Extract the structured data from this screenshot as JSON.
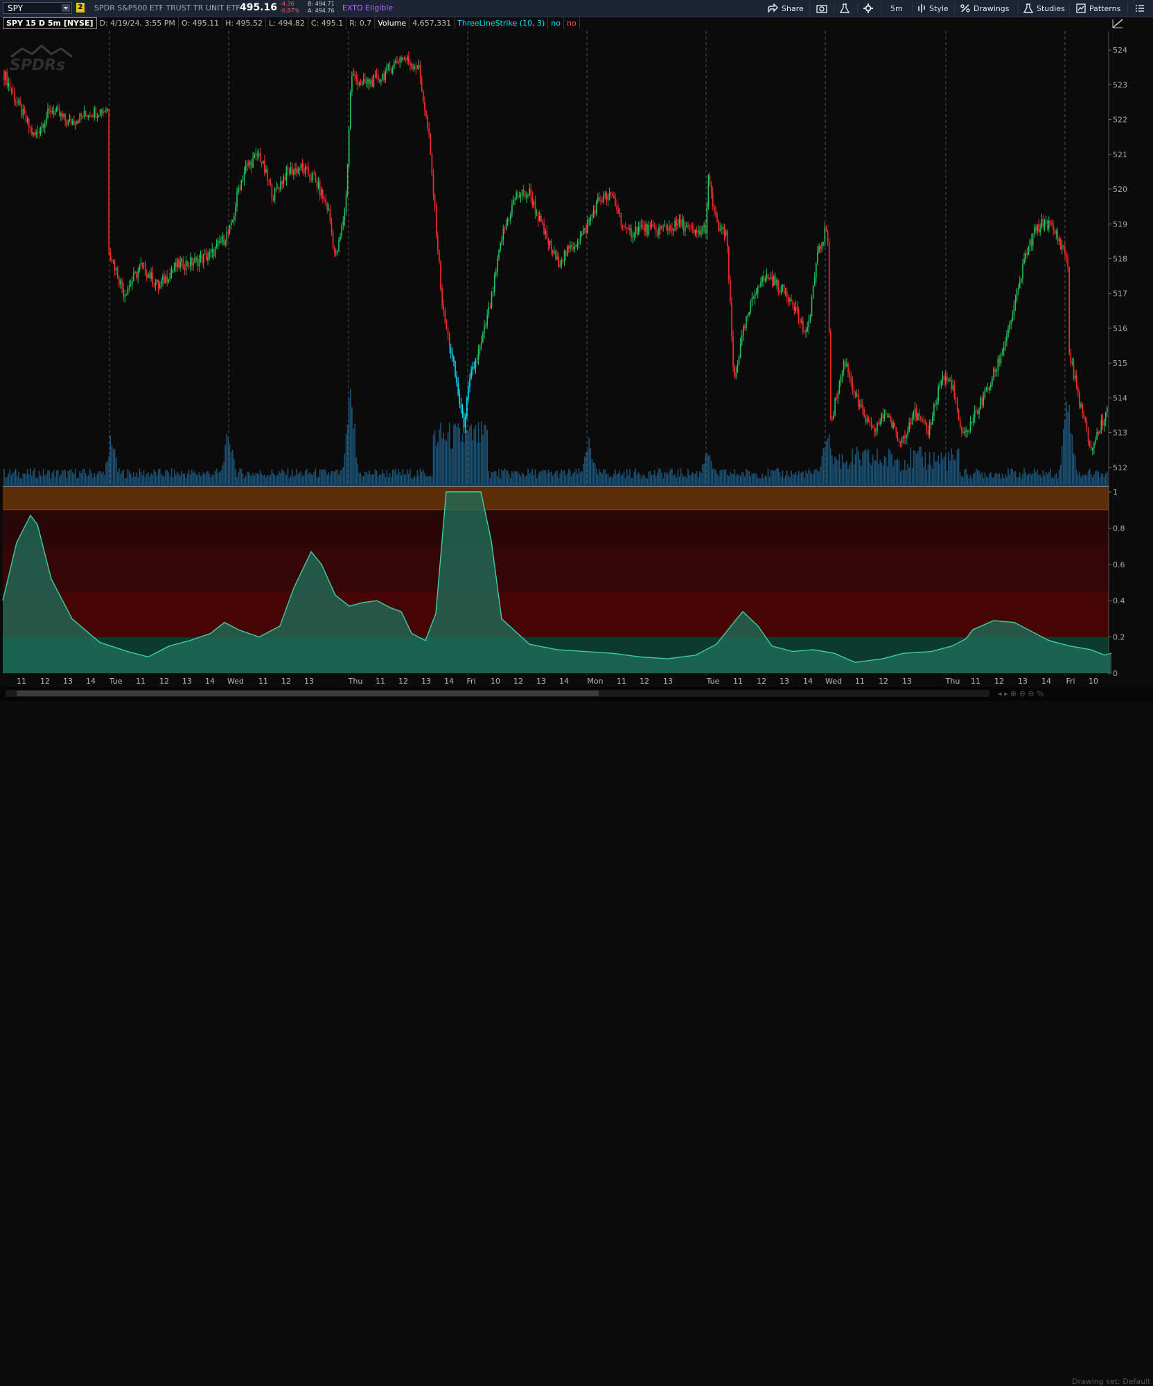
{
  "header": {
    "symbol": "SPY",
    "link_badge": "2",
    "description": "SPDR S&P500 ETF TRUST TR UNIT ETF",
    "last_price": "495.16",
    "net_change": "-4.36",
    "pct_change": "-0.87%",
    "bid": "B: 494.71",
    "ask": "A: 494.76",
    "exto": "EXTO Eligible",
    "buttons": {
      "share": "Share",
      "timeframe": "5m",
      "style": "Style",
      "drawings": "Drawings",
      "studies": "Studies",
      "patterns": "Patterns"
    }
  },
  "legend": {
    "title": "SPY 15 D 5m [NYSE]",
    "date": "D: 4/19/24, 3:55 PM",
    "open": "O: 495.11",
    "high": "H: 495.52",
    "low": "L: 494.82",
    "close": "C: 495.1",
    "range": "R: 0.7",
    "volume_label": "Volume",
    "volume_value": "4,657,331",
    "study": "ThreeLineStrike (10, 3)",
    "study_val1": "no",
    "study_val2": "no"
  },
  "watermark": "SPDRs",
  "colors": {
    "up": "#22c55e",
    "down": "#ff2a2a",
    "signal": "#00e5ff",
    "volume": "#1e5f8a",
    "lower_fill": "#1d6e5a",
    "lower_line": "#3fcfa4"
  },
  "price_axis": {
    "ticks": [
      "524",
      "523",
      "522",
      "521",
      "520",
      "519",
      "518",
      "517",
      "516",
      "515",
      "514",
      "513",
      "512"
    ]
  },
  "lower_axis": {
    "ticks": [
      "1",
      "0.8",
      "0.6",
      "0.4",
      "0.2",
      "0"
    ]
  },
  "time_axis": {
    "labels": [
      "11",
      "12",
      "13",
      "14",
      "Tue",
      "11",
      "12",
      "13",
      "14",
      "Wed",
      "11",
      "12",
      "13",
      "Thu",
      "11",
      "12",
      "13",
      "14",
      "Fri",
      "10",
      "12",
      "13",
      "14",
      "Mon",
      "11",
      "12",
      "13",
      "Tue",
      "11",
      "12",
      "13",
      "14",
      "Wed",
      "11",
      "12",
      "13",
      "Thu",
      "11",
      "12",
      "13",
      "14",
      "Fri",
      "10"
    ]
  },
  "chart_data": {
    "type": "candlestick",
    "ylim": [
      511.5,
      524.5
    ],
    "day_separators": [
      "Tue",
      "Wed",
      "Thu",
      "Fri",
      "Mon",
      "Tue",
      "Wed",
      "Thu",
      "Fri"
    ],
    "price_path": [
      [
        0,
        523.4
      ],
      [
        20,
        522.5
      ],
      [
        45,
        521.5
      ],
      [
        70,
        522.3
      ],
      [
        95,
        521.9
      ],
      [
        125,
        522.2
      ],
      [
        152,
        522.3
      ],
      [
        153,
        518.3
      ],
      [
        175,
        517.0
      ],
      [
        200,
        517.8
      ],
      [
        225,
        517.2
      ],
      [
        250,
        517.8
      ],
      [
        275,
        517.9
      ],
      [
        300,
        518.1
      ],
      [
        320,
        518.6
      ],
      [
        330,
        518.9
      ],
      [
        340,
        520.0
      ],
      [
        350,
        520.6
      ],
      [
        370,
        521.0
      ],
      [
        390,
        519.8
      ],
      [
        410,
        520.5
      ],
      [
        430,
        520.6
      ],
      [
        450,
        520.3
      ],
      [
        470,
        519.4
      ],
      [
        480,
        518.0
      ],
      [
        487,
        518.6
      ],
      [
        495,
        519.6
      ],
      [
        503,
        523.3
      ],
      [
        520,
        523.0
      ],
      [
        545,
        523.2
      ],
      [
        575,
        523.8
      ],
      [
        600,
        523.5
      ],
      [
        615,
        521.5
      ],
      [
        625,
        519.0
      ],
      [
        635,
        516.5
      ],
      [
        650,
        515.0
      ],
      [
        665,
        513.2
      ],
      [
        675,
        514.6
      ],
      [
        690,
        515.5
      ],
      [
        705,
        516.8
      ],
      [
        720,
        518.6
      ],
      [
        740,
        519.8
      ],
      [
        760,
        519.9
      ],
      [
        780,
        518.8
      ],
      [
        800,
        517.9
      ],
      [
        820,
        518.3
      ],
      [
        840,
        518.8
      ],
      [
        860,
        519.7
      ],
      [
        880,
        519.8
      ],
      [
        900,
        518.7
      ],
      [
        920,
        518.9
      ],
      [
        940,
        518.8
      ],
      [
        960,
        518.9
      ],
      [
        980,
        519.0
      ],
      [
        1000,
        518.7
      ],
      [
        1015,
        518.9
      ],
      [
        1018,
        520.3
      ],
      [
        1030,
        519.0
      ],
      [
        1045,
        518.6
      ],
      [
        1055,
        514.5
      ],
      [
        1070,
        516.0
      ],
      [
        1090,
        517.3
      ],
      [
        1105,
        517.5
      ],
      [
        1125,
        517.1
      ],
      [
        1140,
        516.8
      ],
      [
        1160,
        515.7
      ],
      [
        1175,
        518.0
      ],
      [
        1190,
        519.0
      ],
      [
        1195,
        513.3
      ],
      [
        1215,
        515.1
      ],
      [
        1235,
        513.8
      ],
      [
        1255,
        513.0
      ],
      [
        1275,
        513.6
      ],
      [
        1295,
        512.7
      ],
      [
        1315,
        513.6
      ],
      [
        1335,
        513.0
      ],
      [
        1355,
        514.6
      ],
      [
        1370,
        514.4
      ],
      [
        1385,
        512.8
      ],
      [
        1405,
        513.6
      ],
      [
        1425,
        514.4
      ],
      [
        1440,
        515.2
      ],
      [
        1460,
        516.6
      ],
      [
        1475,
        518.0
      ],
      [
        1490,
        518.8
      ],
      [
        1505,
        519.1
      ],
      [
        1520,
        518.7
      ],
      [
        1537,
        518.0
      ],
      [
        1538,
        515.4
      ],
      [
        1555,
        513.8
      ],
      [
        1570,
        512.5
      ],
      [
        1585,
        513.2
      ],
      [
        1598,
        513.9
      ]
    ],
    "signal_range": [
      645,
      683
    ],
    "volume_spikes": [
      [
        157,
        0.45
      ],
      [
        326,
        0.5
      ],
      [
        328,
        0.3
      ],
      [
        502,
        0.85
      ],
      [
        645,
        0.4
      ],
      [
        667,
        0.38
      ],
      [
        846,
        0.45
      ],
      [
        1018,
        0.38
      ],
      [
        1190,
        0.62
      ],
      [
        1537,
        0.95
      ]
    ],
    "lower_study": {
      "name": "ThreeLineStrike (10, 3)",
      "zones": [
        1.0,
        0.9,
        0.7,
        0.45,
        0.2
      ],
      "points": [
        [
          0,
          0.4
        ],
        [
          20,
          0.72
        ],
        [
          40,
          0.87
        ],
        [
          50,
          0.82
        ],
        [
          70,
          0.52
        ],
        [
          100,
          0.3
        ],
        [
          140,
          0.17
        ],
        [
          180,
          0.12
        ],
        [
          210,
          0.09
        ],
        [
          240,
          0.15
        ],
        [
          270,
          0.18
        ],
        [
          300,
          0.22
        ],
        [
          320,
          0.28
        ],
        [
          340,
          0.24
        ],
        [
          370,
          0.2
        ],
        [
          400,
          0.26
        ],
        [
          420,
          0.47
        ],
        [
          445,
          0.67
        ],
        [
          460,
          0.6
        ],
        [
          480,
          0.43
        ],
        [
          500,
          0.37
        ],
        [
          520,
          0.39
        ],
        [
          540,
          0.4
        ],
        [
          560,
          0.36
        ],
        [
          575,
          0.34
        ],
        [
          590,
          0.22
        ],
        [
          610,
          0.18
        ],
        [
          625,
          0.33
        ],
        [
          640,
          1.0
        ],
        [
          690,
          1.0
        ],
        [
          705,
          0.73
        ],
        [
          720,
          0.3
        ],
        [
          760,
          0.16
        ],
        [
          800,
          0.13
        ],
        [
          840,
          0.12
        ],
        [
          880,
          0.11
        ],
        [
          920,
          0.09
        ],
        [
          960,
          0.08
        ],
        [
          1000,
          0.1
        ],
        [
          1030,
          0.16
        ],
        [
          1055,
          0.28
        ],
        [
          1068,
          0.34
        ],
        [
          1090,
          0.26
        ],
        [
          1110,
          0.15
        ],
        [
          1140,
          0.12
        ],
        [
          1170,
          0.13
        ],
        [
          1200,
          0.11
        ],
        [
          1230,
          0.06
        ],
        [
          1270,
          0.08
        ],
        [
          1300,
          0.11
        ],
        [
          1340,
          0.12
        ],
        [
          1370,
          0.15
        ],
        [
          1390,
          0.19
        ],
        [
          1400,
          0.24
        ],
        [
          1430,
          0.29
        ],
        [
          1460,
          0.28
        ],
        [
          1480,
          0.24
        ],
        [
          1510,
          0.18
        ],
        [
          1540,
          0.15
        ],
        [
          1570,
          0.13
        ],
        [
          1590,
          0.1
        ],
        [
          1600,
          0.11
        ]
      ]
    }
  }
}
